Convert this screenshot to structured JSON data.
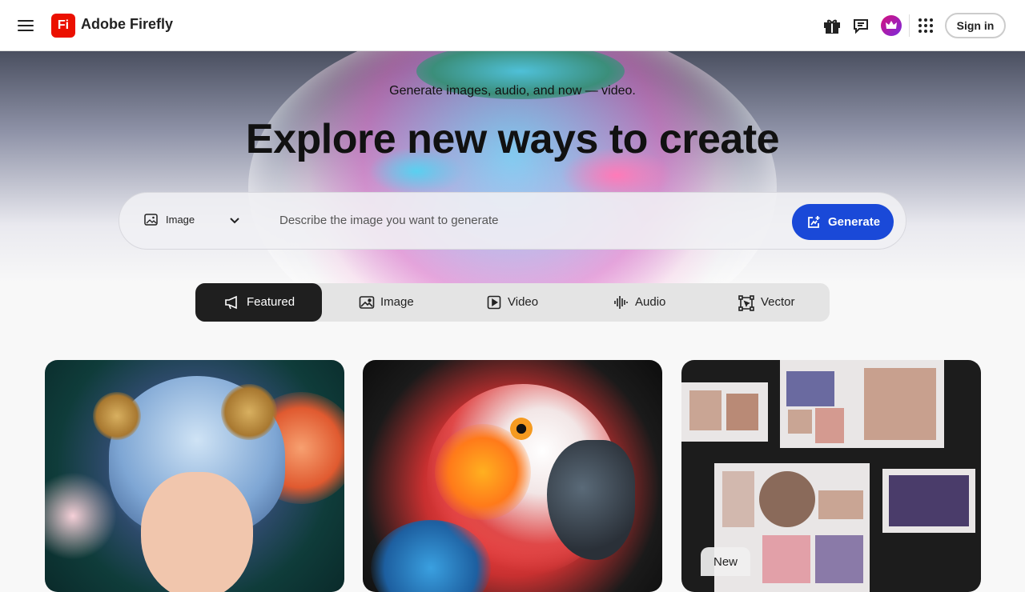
{
  "header": {
    "brand_name": "Adobe Firefly",
    "logo_text": "Fi",
    "sign_in_label": "Sign in"
  },
  "hero": {
    "subtitle": "Generate images, audio, and now — video.",
    "title": "Explore new ways to create"
  },
  "prompt": {
    "type_label": "Image",
    "placeholder": "Describe the image you want to generate",
    "generate_label": "Generate"
  },
  "tabs": [
    {
      "label": "Featured",
      "icon": "megaphone-icon",
      "active": true
    },
    {
      "label": "Image",
      "icon": "image-icon",
      "active": false
    },
    {
      "label": "Video",
      "icon": "video-icon",
      "active": false
    },
    {
      "label": "Audio",
      "icon": "waveform-icon",
      "active": false
    },
    {
      "label": "Vector",
      "icon": "vector-icon",
      "active": false
    }
  ],
  "cards": [
    {
      "badge": ""
    },
    {
      "badge": ""
    },
    {
      "badge": "New"
    }
  ],
  "colors": {
    "accent_blue": "#1a49d8",
    "logo_red": "#eb1000",
    "active_tab": "#1f1f1f"
  }
}
